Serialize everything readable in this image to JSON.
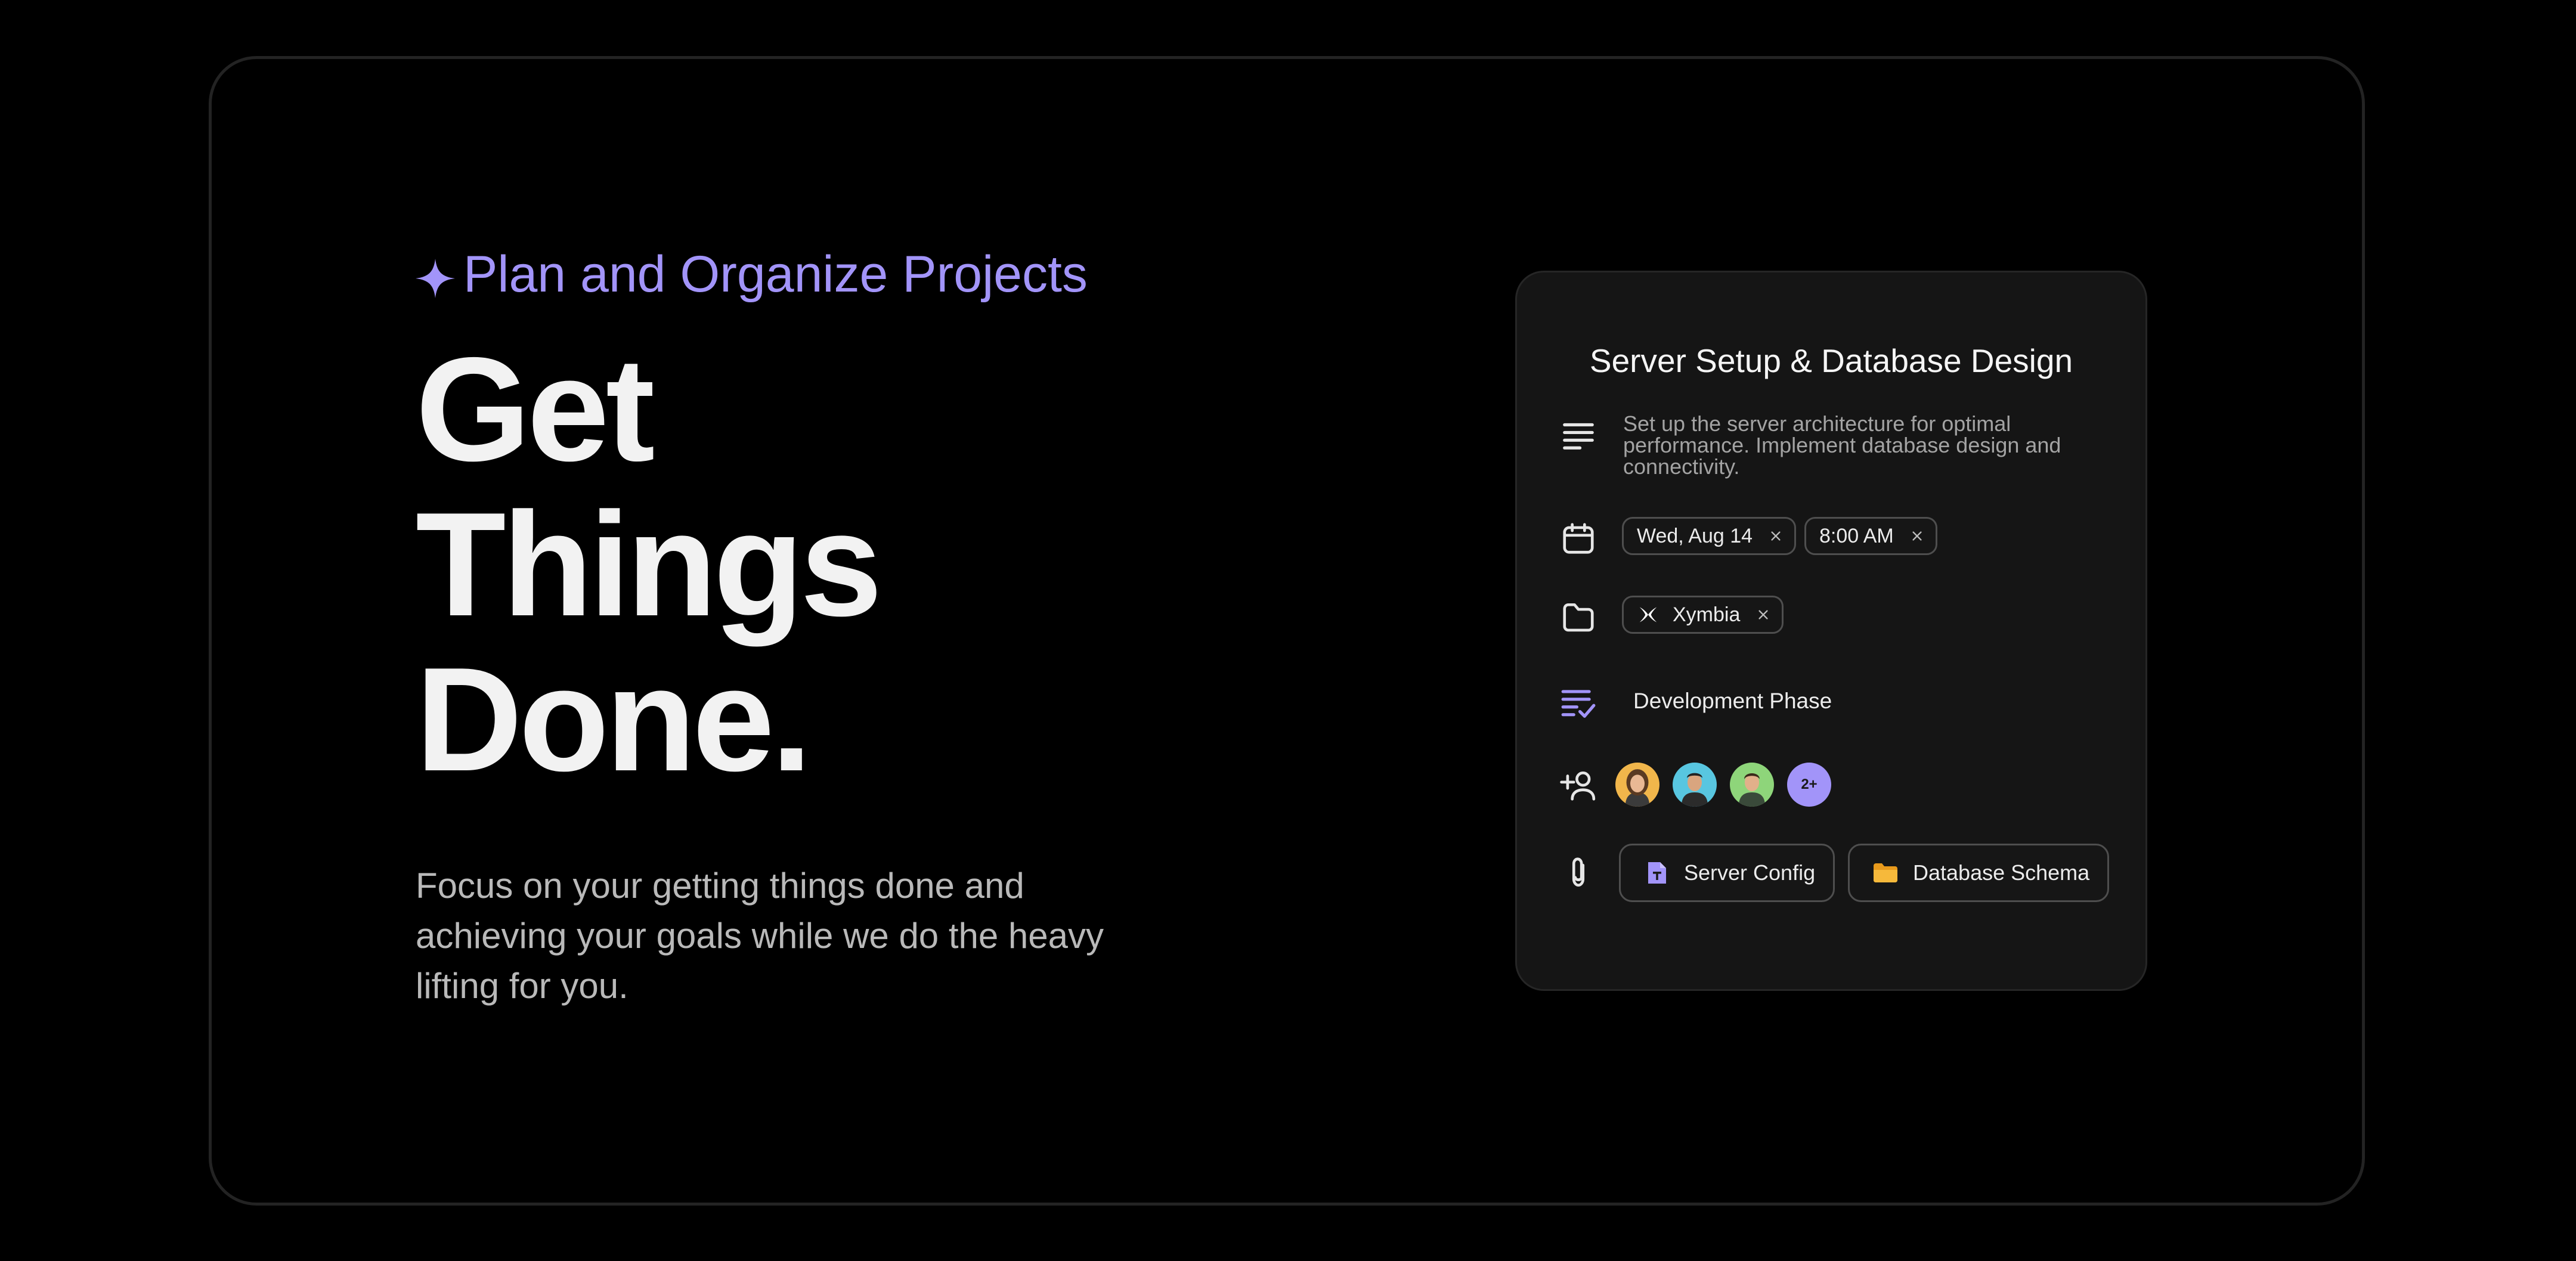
{
  "hero": {
    "eyebrow": "Plan and Organize Projects",
    "headline_lines": [
      "Get",
      "Things",
      "Done."
    ],
    "subtitle": "Focus on your getting things done and achieving your goals while we do the heavy lifting for you."
  },
  "task_card": {
    "title": "Server Setup & Database Design",
    "description": "Set up the server architecture for optimal performance. Implement database design and connectivity.",
    "date": "Wed, Aug 14",
    "time": "8:00 AM",
    "project": "Xymbia",
    "phase": "Development Phase",
    "assignees_more": "2+",
    "attachments": [
      "Server Config",
      "Database Schema"
    ]
  },
  "colors": {
    "accent": "#a294f9",
    "background": "#000000",
    "card": "#151515",
    "chip_border": "#4e4e4e"
  },
  "icons": {
    "eyebrow": "sparkle-icon",
    "description": "text-lines-icon",
    "date": "calendar-icon",
    "project": "folder-icon",
    "phase": "checklist-icon",
    "assignees": "add-user-icon",
    "attachments": "paperclip-icon"
  }
}
